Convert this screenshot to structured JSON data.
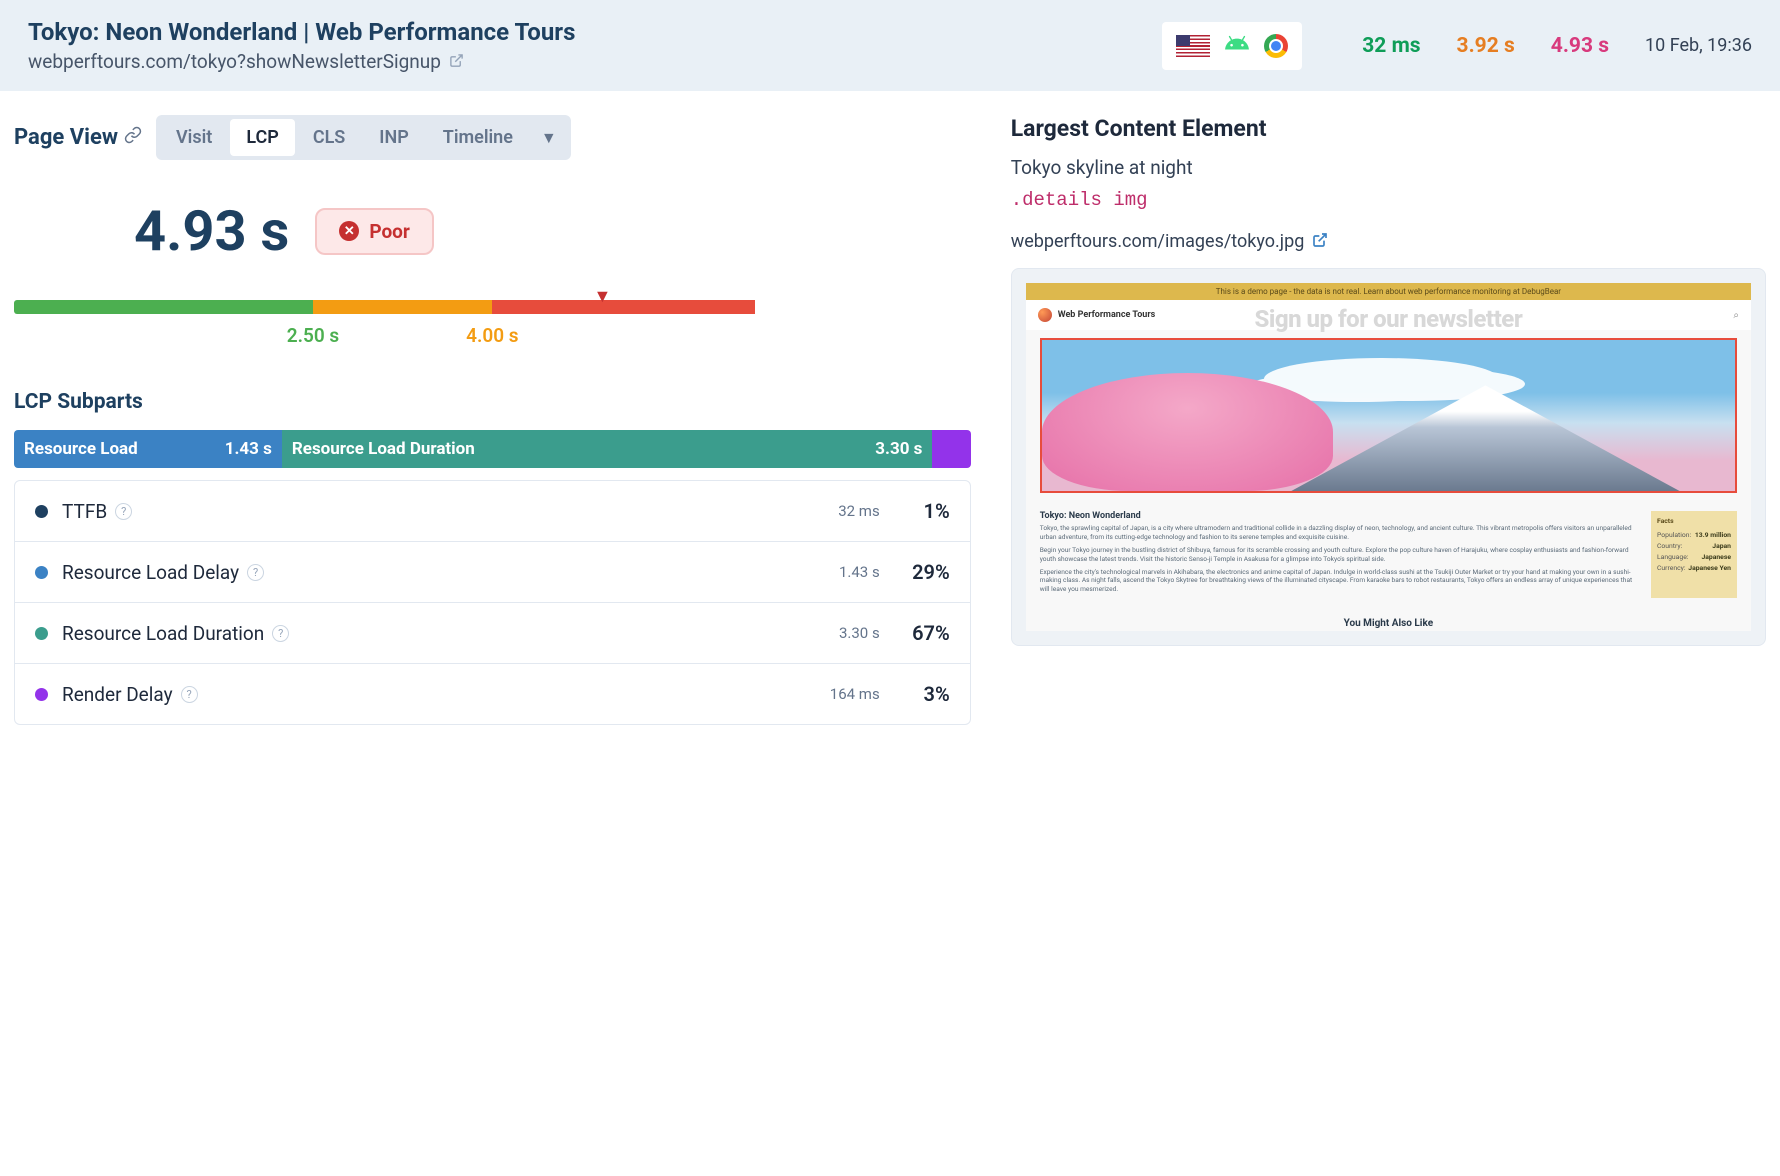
{
  "header": {
    "title": "Tokyo: Neon Wonderland | Web Performance Tours",
    "url": "webperftours.com/tokyo?showNewsletterSignup",
    "metrics": {
      "ttfb": "32 ms",
      "metric2": "3.92 s",
      "lcp": "4.93 s"
    },
    "timestamp": "10 Feb, 19:36"
  },
  "view": {
    "label": "Page View",
    "tabs": [
      "Visit",
      "LCP",
      "CLS",
      "INP",
      "Timeline"
    ],
    "active_tab": "LCP"
  },
  "main_metric": {
    "value": "4.93 s",
    "status": "Poor"
  },
  "thresholds": {
    "good": "2.50 s",
    "needs_improvement": "4.00 s"
  },
  "subparts": {
    "title": "LCP Subparts",
    "bar": [
      {
        "label": "Resource Load",
        "value": "1.43 s"
      },
      {
        "label": "Resource Load Duration",
        "value": "3.30 s"
      }
    ],
    "rows": [
      {
        "color": "#1e4060",
        "name": "TTFB",
        "time": "32 ms",
        "pct": "1%"
      },
      {
        "color": "#3b82c4",
        "name": "Resource Load Delay",
        "time": "1.43 s",
        "pct": "29%"
      },
      {
        "color": "#3b9d8d",
        "name": "Resource Load Duration",
        "time": "3.30 s",
        "pct": "67%"
      },
      {
        "color": "#9333ea",
        "name": "Render Delay",
        "time": "164 ms",
        "pct": "3%"
      }
    ]
  },
  "lce": {
    "title": "Largest Content Element",
    "desc": "Tokyo skyline at night",
    "selector": ".details img",
    "url": "webperftours.com/images/tokyo.jpg"
  },
  "preview": {
    "banner": "This is a demo page - the data is not real. Learn about web performance monitoring at DebugBear",
    "brand": "Web Performance Tours",
    "newsletter": "Sign up for our newsletter",
    "article_title": "Tokyo: Neon Wonderland",
    "para1": "Tokyo, the sprawling capital of Japan, is a city where ultramodern and traditional collide in a dazzling display of neon, technology, and ancient culture. This vibrant metropolis offers visitors an unparalleled urban adventure, from its cutting-edge technology and fashion to its serene temples and exquisite cuisine.",
    "para2": "Begin your Tokyo journey in the bustling district of Shibuya, famous for its scramble crossing and youth culture. Explore the pop culture haven of Harajuku, where cosplay enthusiasts and fashion-forward youth showcase the latest trends. Visit the historic Senso-ji Temple in Asakusa for a glimpse into Tokyo's spiritual side.",
    "para3": "Experience the city's technological marvels in Akihabara, the electronics and anime capital of Japan. Indulge in world-class sushi at the Tsukiji Outer Market or try your hand at making your own in a sushi-making class. As night falls, ascend the Tokyo Skytree for breathtaking views of the illuminated cityscape. From karaoke bars to robot restaurants, Tokyo offers an endless array of unique experiences that will leave you mesmerized.",
    "facts_title": "Facts",
    "facts": [
      {
        "label": "Population:",
        "value": "13.9 million"
      },
      {
        "label": "Country:",
        "value": "Japan"
      },
      {
        "label": "Language:",
        "value": "Japanese"
      },
      {
        "label": "Currency:",
        "value": "Japanese Yen"
      }
    ],
    "footer": "You Might Also Like"
  }
}
